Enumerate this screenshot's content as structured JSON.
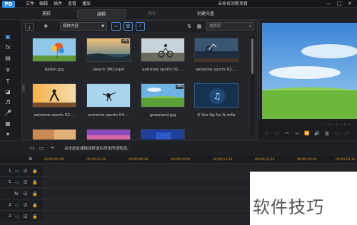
{
  "titlebar": {
    "menus": [
      "文件",
      "编辑",
      "插件",
      "查看",
      "播放"
    ],
    "project_title": "未命名的新项目",
    "window_buttons": [
      "—",
      "□",
      "✕"
    ]
  },
  "modes": [
    {
      "label": "捕获",
      "state": "normal"
    },
    {
      "label": "编辑",
      "state": "active"
    },
    {
      "label": "制作",
      "state": "disabled"
    },
    {
      "label": "创建光盘",
      "state": "normal"
    }
  ],
  "library": {
    "filter": "媒体内容",
    "search_placeholder": "搜索库",
    "media": [
      {
        "name": "ballon.jpg",
        "badge": ""
      },
      {
        "name": "beach 360.mp4",
        "badge": "360"
      },
      {
        "name": "extreme sports 01....",
        "badge": ""
      },
      {
        "name": "extreme sports 02....",
        "badge": ""
      },
      {
        "name": "extreme sports 03....",
        "badge": ""
      },
      {
        "name": "extreme sports 04....",
        "badge": ""
      },
      {
        "name": "grassland.jpg",
        "badge": "360"
      },
      {
        "name": "R You Up for It.m4a",
        "badge": ""
      }
    ]
  },
  "preview": {
    "timecode": "- - ; - - ; - - ; - -"
  },
  "timeline": {
    "hint": "点击此处或拖动所选片段至所选轨道。",
    "ruler": [
      "00;00;00;00",
      "00;00;03;10",
      "00;00;06;20",
      "00;00;10;00",
      "00;00;13;10",
      "00;00;16;20",
      "00;00;20;00",
      "00;00;23;10"
    ],
    "tracks": [
      {
        "num": "1.",
        "type": "video-icon"
      },
      {
        "num": "1.",
        "type": "audio-icon"
      },
      {
        "num": "",
        "type": "fx-icon"
      },
      {
        "num": "2.",
        "type": "video-icon"
      },
      {
        "num": "2.",
        "type": "audio-icon"
      }
    ]
  },
  "watermark": {
    "text": "软件技巧"
  },
  "colors": {
    "accent": "#2c8be6",
    "ruler": "#d79b2a",
    "background": "#1b1c1f"
  }
}
